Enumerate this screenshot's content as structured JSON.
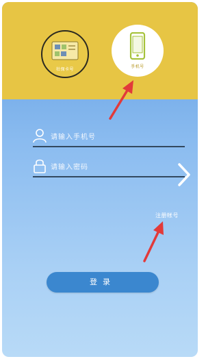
{
  "login_options": {
    "card": {
      "label": "社保卡号",
      "icon": "card-icon"
    },
    "phone": {
      "label": "手机号",
      "icon": "phone-icon"
    }
  },
  "phone_field": {
    "placeholder": "请输入手机号",
    "value": "",
    "icon": "user-icon"
  },
  "password_field": {
    "placeholder": "请输入密码",
    "value": "",
    "icon": "lock-icon"
  },
  "register_link": "注册帐号",
  "login_button": "登录",
  "colors": {
    "header": "#e7c544",
    "background": "#8bbcf0",
    "button": "#3b87cf",
    "annotation_arrow": "#e23a3a",
    "phone_icon": "#a5c23a"
  }
}
